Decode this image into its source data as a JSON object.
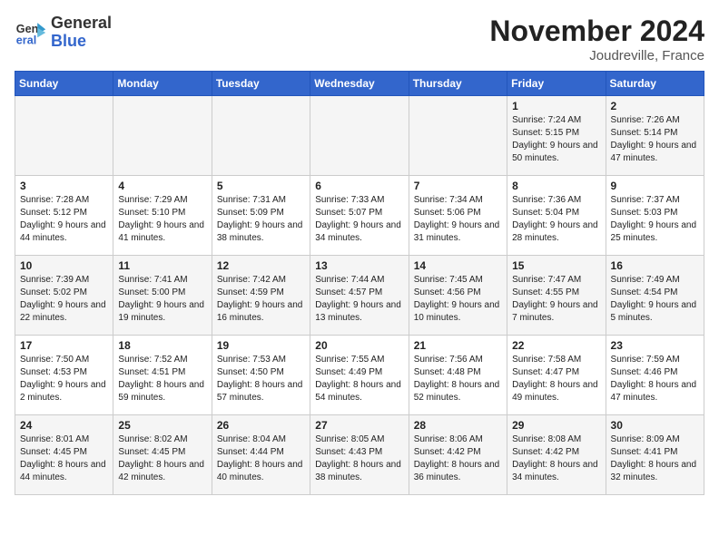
{
  "logo": {
    "line1": "General",
    "line2": "Blue"
  },
  "title": "November 2024",
  "location": "Joudreville, France",
  "days_of_week": [
    "Sunday",
    "Monday",
    "Tuesday",
    "Wednesday",
    "Thursday",
    "Friday",
    "Saturday"
  ],
  "weeks": [
    [
      {
        "day": "",
        "info": ""
      },
      {
        "day": "",
        "info": ""
      },
      {
        "day": "",
        "info": ""
      },
      {
        "day": "",
        "info": ""
      },
      {
        "day": "",
        "info": ""
      },
      {
        "day": "1",
        "info": "Sunrise: 7:24 AM\nSunset: 5:15 PM\nDaylight: 9 hours and 50 minutes."
      },
      {
        "day": "2",
        "info": "Sunrise: 7:26 AM\nSunset: 5:14 PM\nDaylight: 9 hours and 47 minutes."
      }
    ],
    [
      {
        "day": "3",
        "info": "Sunrise: 7:28 AM\nSunset: 5:12 PM\nDaylight: 9 hours and 44 minutes."
      },
      {
        "day": "4",
        "info": "Sunrise: 7:29 AM\nSunset: 5:10 PM\nDaylight: 9 hours and 41 minutes."
      },
      {
        "day": "5",
        "info": "Sunrise: 7:31 AM\nSunset: 5:09 PM\nDaylight: 9 hours and 38 minutes."
      },
      {
        "day": "6",
        "info": "Sunrise: 7:33 AM\nSunset: 5:07 PM\nDaylight: 9 hours and 34 minutes."
      },
      {
        "day": "7",
        "info": "Sunrise: 7:34 AM\nSunset: 5:06 PM\nDaylight: 9 hours and 31 minutes."
      },
      {
        "day": "8",
        "info": "Sunrise: 7:36 AM\nSunset: 5:04 PM\nDaylight: 9 hours and 28 minutes."
      },
      {
        "day": "9",
        "info": "Sunrise: 7:37 AM\nSunset: 5:03 PM\nDaylight: 9 hours and 25 minutes."
      }
    ],
    [
      {
        "day": "10",
        "info": "Sunrise: 7:39 AM\nSunset: 5:02 PM\nDaylight: 9 hours and 22 minutes."
      },
      {
        "day": "11",
        "info": "Sunrise: 7:41 AM\nSunset: 5:00 PM\nDaylight: 9 hours and 19 minutes."
      },
      {
        "day": "12",
        "info": "Sunrise: 7:42 AM\nSunset: 4:59 PM\nDaylight: 9 hours and 16 minutes."
      },
      {
        "day": "13",
        "info": "Sunrise: 7:44 AM\nSunset: 4:57 PM\nDaylight: 9 hours and 13 minutes."
      },
      {
        "day": "14",
        "info": "Sunrise: 7:45 AM\nSunset: 4:56 PM\nDaylight: 9 hours and 10 minutes."
      },
      {
        "day": "15",
        "info": "Sunrise: 7:47 AM\nSunset: 4:55 PM\nDaylight: 9 hours and 7 minutes."
      },
      {
        "day": "16",
        "info": "Sunrise: 7:49 AM\nSunset: 4:54 PM\nDaylight: 9 hours and 5 minutes."
      }
    ],
    [
      {
        "day": "17",
        "info": "Sunrise: 7:50 AM\nSunset: 4:53 PM\nDaylight: 9 hours and 2 minutes."
      },
      {
        "day": "18",
        "info": "Sunrise: 7:52 AM\nSunset: 4:51 PM\nDaylight: 8 hours and 59 minutes."
      },
      {
        "day": "19",
        "info": "Sunrise: 7:53 AM\nSunset: 4:50 PM\nDaylight: 8 hours and 57 minutes."
      },
      {
        "day": "20",
        "info": "Sunrise: 7:55 AM\nSunset: 4:49 PM\nDaylight: 8 hours and 54 minutes."
      },
      {
        "day": "21",
        "info": "Sunrise: 7:56 AM\nSunset: 4:48 PM\nDaylight: 8 hours and 52 minutes."
      },
      {
        "day": "22",
        "info": "Sunrise: 7:58 AM\nSunset: 4:47 PM\nDaylight: 8 hours and 49 minutes."
      },
      {
        "day": "23",
        "info": "Sunrise: 7:59 AM\nSunset: 4:46 PM\nDaylight: 8 hours and 47 minutes."
      }
    ],
    [
      {
        "day": "24",
        "info": "Sunrise: 8:01 AM\nSunset: 4:45 PM\nDaylight: 8 hours and 44 minutes."
      },
      {
        "day": "25",
        "info": "Sunrise: 8:02 AM\nSunset: 4:45 PM\nDaylight: 8 hours and 42 minutes."
      },
      {
        "day": "26",
        "info": "Sunrise: 8:04 AM\nSunset: 4:44 PM\nDaylight: 8 hours and 40 minutes."
      },
      {
        "day": "27",
        "info": "Sunrise: 8:05 AM\nSunset: 4:43 PM\nDaylight: 8 hours and 38 minutes."
      },
      {
        "day": "28",
        "info": "Sunrise: 8:06 AM\nSunset: 4:42 PM\nDaylight: 8 hours and 36 minutes."
      },
      {
        "day": "29",
        "info": "Sunrise: 8:08 AM\nSunset: 4:42 PM\nDaylight: 8 hours and 34 minutes."
      },
      {
        "day": "30",
        "info": "Sunrise: 8:09 AM\nSunset: 4:41 PM\nDaylight: 8 hours and 32 minutes."
      }
    ]
  ]
}
